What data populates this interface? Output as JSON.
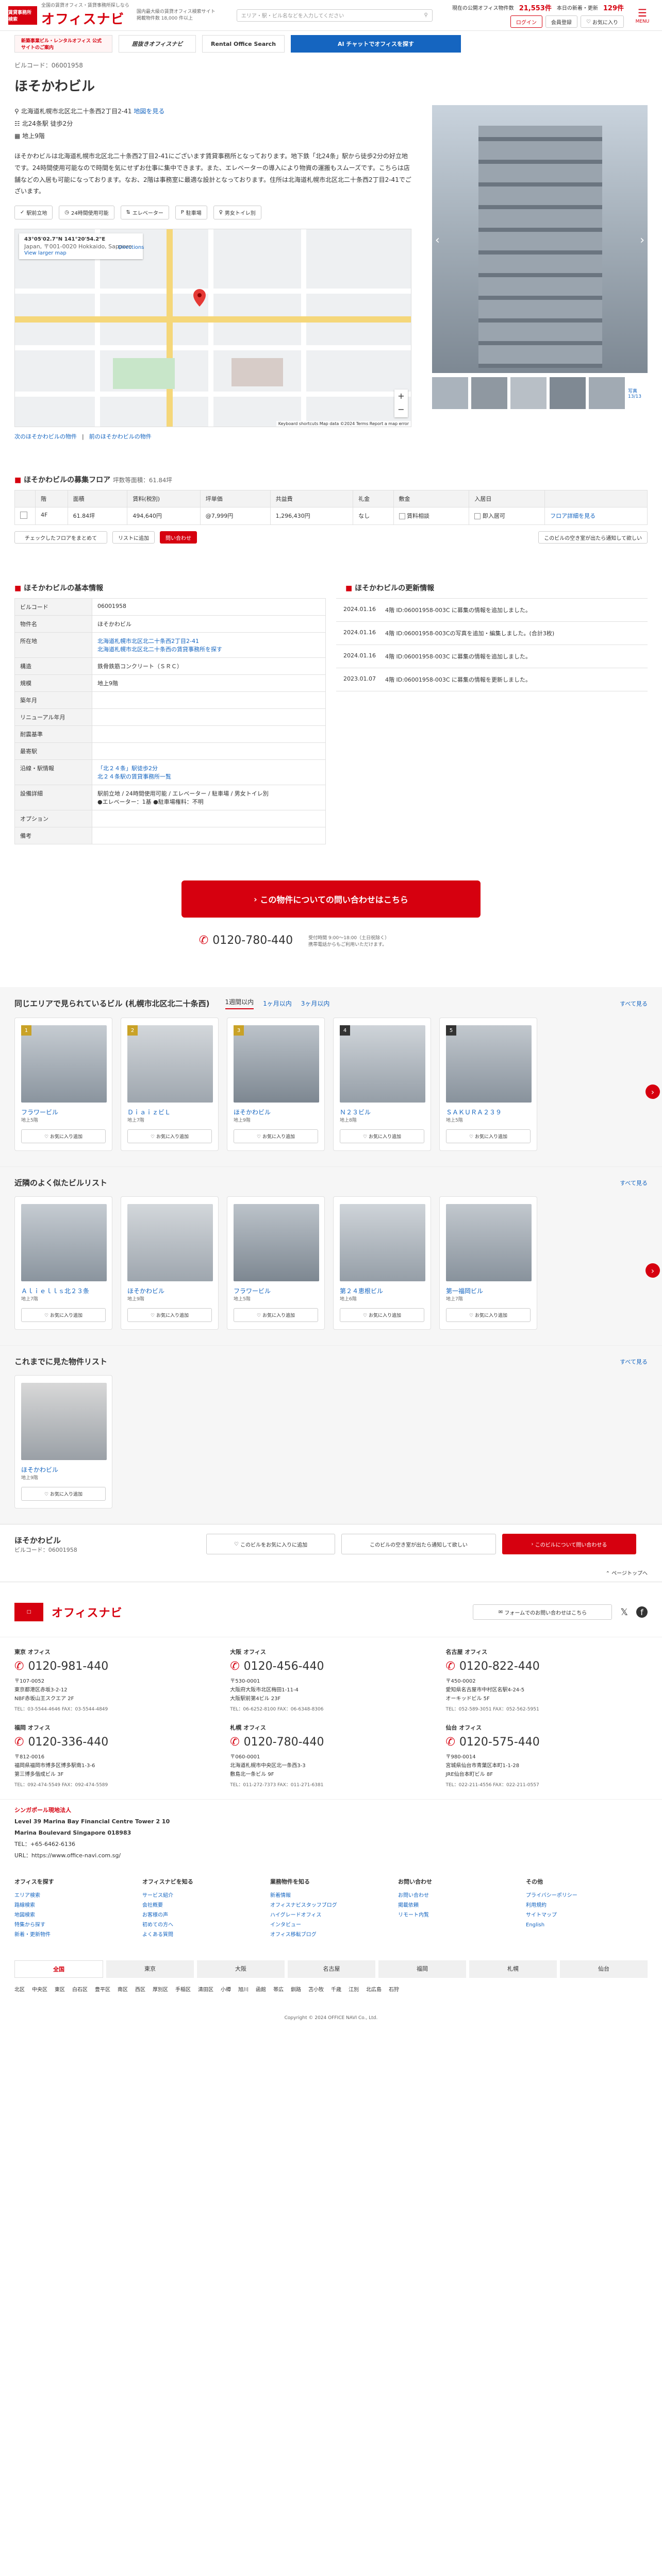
{
  "header": {
    "logo_small": "賃貸事務所 検索",
    "logo": "オフィスナビ",
    "tagline1": "全国の賃貸オフィス・賃貸事務所探しなら",
    "tagline2": "国内最大級の賃貸オフィス検索サイト",
    "tagline3": "掲載物件数 18,000 件以上",
    "search_placeholder": "エリア・駅・ビル名などを入力してください",
    "stat1_label": "現在の公開オフィス物件数",
    "stat1_value": "21,553件",
    "stat2_label": "本日の新着・更新",
    "stat2_value": "129件",
    "login": "ログイン",
    "register": "会員登録",
    "favorites": "お気に入り",
    "menu": "MENU"
  },
  "banners": [
    {
      "label": "新築事業ビル・レンタルオフィス 公式サイトのご案内"
    },
    {
      "label": "居抜きオフィスナビ"
    },
    {
      "label": "Rental Office Search"
    },
    {
      "label": "AI チャットでオフィスを探す"
    }
  ],
  "crumb": "ビルコード：06001958",
  "building": {
    "name": "ほそかわビル",
    "address": "北海道札幌市北区北二十条西2丁目2-41",
    "map_link": "地図を見る",
    "station": "北24条駅 徒歩2分",
    "floors": "地上9階",
    "description": "ほそかわビルは北海道札幌市北区北二十条西2丁目2-41にございます賃貸事務所となっております。地下鉄「北24条」駅から徒歩2分の好立地です。24時間使用可能なので時間を気にせずお仕事に集中できます。また、エレベーターの導入により物資の運搬もスムーズです。こちらは店舗などの入居も可能になっております。なお、2階は事務室に最適な設計となっております。住所は北海道札幌市北区北二十条西2丁目2-41でございます。",
    "tags": [
      "駅前立地",
      "24時間使用可能",
      "エレベーター",
      "駐車場",
      "男女トイレ別"
    ],
    "map_coord": "43°05'02.7\"N 141°20'54.2\"E",
    "map_addr": "Japan, 〒001-0020 Hokkaido, Sapporo",
    "map_view": "View larger map",
    "map_dir": "Directions",
    "map_credit": "Keyboard shortcuts   Map data ©2024   Terms   Report a map error",
    "next_link": "次のほそかわビルの物件",
    "prev_link": "前のほそかわビルの物件",
    "photo_count": "写真 13/13"
  },
  "vacancy": {
    "title": "ほそかわビルの募集フロア",
    "sub": "坪数等面積：61.84坪",
    "head": [
      "階",
      "面積",
      "賃料(税別)",
      "坪単価",
      "共益費",
      "礼金",
      "敷金",
      "入居日"
    ],
    "row": [
      "4F",
      "61.84坪",
      "494,640円",
      "@7,999円",
      "1,296,430円",
      "なし",
      "",
      "即入居可"
    ],
    "consult": "賃料相談",
    "floor_link": "フロア詳細を見る",
    "check_all": "チェックしたフロアをまとめて",
    "list_btn": "リストに追加",
    "contact_btn": "問い合わせ",
    "note": "このビルの空き室が出たら通知して欲しい"
  },
  "info": {
    "title": "ほそかわビルの基本情報",
    "rows": [
      {
        "k": "ビルコード",
        "v": "06001958"
      },
      {
        "k": "物件名",
        "v": "ほそかわビル"
      },
      {
        "k": "所在地",
        "v": "北海道札幌市北区北二十条西2丁目2-41\n北海道札幌市北区北二十条西の賃貸事務所を探す"
      },
      {
        "k": "構造",
        "v": "鉄骨鉄筋コンクリート（ＳＲＣ）"
      },
      {
        "k": "規模",
        "v": "地上9階"
      },
      {
        "k": "築年月",
        "v": ""
      },
      {
        "k": "リニューアル年月",
        "v": ""
      },
      {
        "k": "耐震基準",
        "v": ""
      },
      {
        "k": "最寄駅",
        "v": ""
      },
      {
        "k": "沿線・駅情報",
        "v": "「北２４条」駅徒歩2分\n北２４条駅の賃貸事務所一覧"
      },
      {
        "k": "設備詳細",
        "v": "駅前立地 / 24時間使用可能 / エレベーター / 駐車場 / 男女トイレ別\n●エレベーター：1基 ●駐車場権料：不明"
      },
      {
        "k": "オプション",
        "v": ""
      },
      {
        "k": "備考",
        "v": ""
      }
    ]
  },
  "history": {
    "title": "ほそかわビルの更新情報",
    "items": [
      {
        "d": "2024.01.16",
        "t": "4階 ID:06001958-003C に募集の情報を追加しました。"
      },
      {
        "d": "2024.01.16",
        "t": "4階 ID:06001958-003Cの写真を追加・編集しました。(合計3枚)"
      },
      {
        "d": "2024.01.16",
        "t": "4階 ID:06001958-003C に募集の情報を追加しました。"
      },
      {
        "d": "2023.01.07",
        "t": "4階 ID:06001958-003C に募集の情報を更新しました。"
      }
    ]
  },
  "cta": {
    "btn": "この物件についての問い合わせはこちら",
    "tel": "0120-780-440",
    "note": "受付時間 9:00～18:00（土日祝除く）\n携帯電話からもご利用いただけます。"
  },
  "seen": {
    "title": "同じエリアで見られているビル (札幌市北区北二十条西)",
    "tabs": [
      "1週間以内",
      "1ヶ月以内",
      "3ヶ月以内"
    ],
    "more": "すべて見る",
    "cards": [
      {
        "n": "1",
        "name": "フラワービル",
        "sub": "地上5階"
      },
      {
        "n": "2",
        "name": "ＤｉａｉｚビＬ",
        "sub": "地上7階"
      },
      {
        "n": "3",
        "name": "ほそかわビル",
        "sub": "地上9階"
      },
      {
        "n": "4",
        "name": "Ｎ２３ビル",
        "sub": "地上8階"
      },
      {
        "n": "5",
        "name": "ＳＡＫＵＲＡ２３９",
        "sub": "地上5階"
      }
    ],
    "fav": "お気に入り追加"
  },
  "near": {
    "title": "近隣のよく似たビルリスト",
    "more": "すべて見る",
    "cards": [
      {
        "name": "Ａｌｉｅｌｌｓ北２３条",
        "sub": "地上7階"
      },
      {
        "name": "ほそかわビル",
        "sub": "地上9階"
      },
      {
        "name": "フラワービル",
        "sub": "地上5階"
      },
      {
        "name": "第２４恵根ビル",
        "sub": "地上6階"
      },
      {
        "name": "第一福岡ビル",
        "sub": "地上7階"
      }
    ],
    "fav": "お気に入り追加"
  },
  "history_seen": {
    "title": "これまでに見た物件リスト",
    "more": "すべて見る",
    "card": {
      "name": "ほそかわビル",
      "sub": "地上9階"
    },
    "fav": "お気に入り追加"
  },
  "sticky": {
    "name": "ほそかわビル",
    "code": "ビルコード：06001958",
    "fav": "このビルをお気に入りに追加",
    "notify": "このビルの空き室が出たら通知して欲しい",
    "contact": "このビルについて問い合わせる",
    "pagetop": "ページトップへ"
  },
  "footer": {
    "logo": "オフィスナビ",
    "form_btn": "フォームでのお問い合わせはこちら",
    "offices": [
      {
        "name": "東京 オフィス",
        "tel": "0120-981-440",
        "addr": "〒107-0052\n東京都港区赤坂3-2-12\nNBF赤坂山王スクエア 2F",
        "fax": "TEL：03-5544-4646 FAX：03-5544-4849"
      },
      {
        "name": "大阪 オフィス",
        "tel": "0120-456-440",
        "addr": "〒530-0001\n大阪府大阪市北区梅田1-11-4\n大阪駅前第4ビル 23F",
        "fax": "TEL：06-6252-8100 FAX：06-6348-8306"
      },
      {
        "name": "名古屋 オフィス",
        "tel": "0120-822-440",
        "addr": "〒450-0002\n愛知県名古屋市中村区名駅4-24-5\nオーキッドビル 5F",
        "fax": "TEL：052-589-3051 FAX：052-562-5951"
      },
      {
        "name": "福岡 オフィス",
        "tel": "0120-336-440",
        "addr": "〒812-0016\n福岡県福岡市博多区博多駅南1-3-6\n第三博多偕成ビル 3F",
        "fax": "TEL：092-474-5549 FAX：092-474-5589"
      },
      {
        "name": "札幌 オフィス",
        "tel": "0120-780-440",
        "addr": "〒060-0001\n北海道札幌市中央区北一条西3-3\n敷島北一条ビル 9F",
        "fax": "TEL：011-272-7373 FAX：011-271-6381"
      },
      {
        "name": "仙台 オフィス",
        "tel": "0120-575-440",
        "addr": "〒980-0014\n宮城県仙台市青葉区本町1-1-28\nJRE仙台本町ビル 8F",
        "fax": "TEL：022-211-4556 FAX：022-211-0557"
      }
    ],
    "sg_title": "シンガポール現地法人",
    "sg_addr": "Level 39 Marina Bay Financial Centre Tower 2 10\nMarina Boulevard Singapore 018983",
    "sg_tel": "TEL：+65-6462-6136\nURL：https://www.office-navi.com.sg/",
    "cols": [
      {
        "h": "オフィスを探す",
        "items": [
          "エリア検索",
          "路線検索",
          "地図検索",
          "特集から探す",
          "新着・更新物件"
        ]
      },
      {
        "h": "オフィスナビを知る",
        "items": [
          "サービス紹介",
          "会社概要",
          "お客様の声",
          "初めての方へ",
          "よくある質問"
        ]
      },
      {
        "h": "業務物件を知る",
        "items": [
          "新着情報",
          "オフィスナビスタッフブログ",
          "ハイグレードオフィス",
          "インタビュー",
          "オフィス移転ブログ"
        ]
      },
      {
        "h": "お問い合わせ",
        "items": [
          "お問い合わせ",
          "掲載依頼",
          "リモート内覧"
        ]
      },
      {
        "h": "その他",
        "items": [
          "プライバシーポリシー",
          "利用規約",
          "サイトマップ",
          "English"
        ]
      }
    ],
    "cities": [
      "全国",
      "東京",
      "大阪",
      "名古屋",
      "福岡",
      "札幌",
      "仙台"
    ],
    "wards": [
      "北区",
      "中央区",
      "東区",
      "白石区",
      "豊平区",
      "南区",
      "西区",
      "厚別区",
      "手稲区",
      "清田区",
      "小樽",
      "旭川",
      "函館",
      "帯広",
      "釧路",
      "苫小牧",
      "千歳",
      "江別",
      "北広島",
      "石狩"
    ],
    "copyright": "Copyright © 2024 OFFICE NAVI Co., Ltd."
  }
}
